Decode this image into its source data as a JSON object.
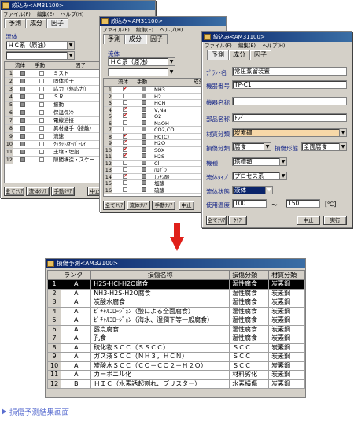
{
  "window1": {
    "title": "絞込み<AM31100>",
    "menu": [
      "ファイル(F)",
      "編集(E)",
      "ヘルプ(H)"
    ],
    "tabs": [
      "予測",
      "成分",
      "因子"
    ],
    "fluid_label": "流体",
    "fluid_value": "ＨＣ系（原油）",
    "grid_head": [
      "流体",
      "手動",
      "因子"
    ],
    "rows": [
      {
        "n": "1",
        "t": "ミスト"
      },
      {
        "n": "2",
        "t": "固体粒子"
      },
      {
        "n": "3",
        "t": "応力（熱応力）"
      },
      {
        "n": "4",
        "t": "ＳＲ"
      },
      {
        "n": "5",
        "t": "振動"
      },
      {
        "n": "6",
        "t": "保温保冷"
      },
      {
        "n": "7",
        "t": "電線溶接"
      },
      {
        "n": "8",
        "t": "異材継手（接触）"
      },
      {
        "n": "9",
        "t": "流速"
      },
      {
        "n": "10",
        "t": "ｸｯｸｯﾄ/ｵｰﾊﾞｰﾚｲ"
      },
      {
        "n": "11",
        "t": "土壌・埋設"
      },
      {
        "n": "12",
        "t": "隙間構造・スケー"
      }
    ],
    "buttons": [
      "全てｸﾘｱ",
      "流体ｸﾘｱ",
      "手動ｸﾘｱ",
      "中止"
    ]
  },
  "window2": {
    "title": "絞込み<AM31100>",
    "menu": [
      "ファイル(F)",
      "編集(E)",
      "ヘルプ(H)"
    ],
    "tabs": [
      "予測",
      "成分",
      "因子"
    ],
    "fluid_label": "流体",
    "fluid_value": "ＨＣ系（原油）",
    "grid_head": [
      "流体",
      "手動",
      "成分"
    ],
    "rows": [
      {
        "n": "1",
        "t": "NH3",
        "chk": true
      },
      {
        "n": "2",
        "t": "H2",
        "chk": false
      },
      {
        "n": "3",
        "t": "HCN",
        "chk": false
      },
      {
        "n": "4",
        "t": "V,Na",
        "chk": true
      },
      {
        "n": "5",
        "t": "O2",
        "chk": true
      },
      {
        "n": "6",
        "t": "NaOH",
        "chk": false
      },
      {
        "n": "7",
        "t": "CO2,CO",
        "chk": false
      },
      {
        "n": "8",
        "t": "HC(C)",
        "chk": true
      },
      {
        "n": "9",
        "t": "H2O",
        "chk": true
      },
      {
        "n": "10",
        "t": "SOX",
        "chk": true
      },
      {
        "n": "11",
        "t": "H2S",
        "chk": true
      },
      {
        "n": "12",
        "t": "Cl-",
        "chk": false
      },
      {
        "n": "13",
        "t": "ﾊﾛｹﾞﾝ",
        "chk": false
      },
      {
        "n": "14",
        "t": "ﾅﾌﾃﾝ酸",
        "chk": true
      },
      {
        "n": "15",
        "t": "塩酸",
        "chk": false
      },
      {
        "n": "16",
        "t": "硫酸",
        "chk": false
      }
    ],
    "buttons": [
      "全てｸﾘｱ",
      "流体ｸﾘｱ",
      "手動ｸﾘｱ",
      "中止"
    ]
  },
  "window3": {
    "title": "絞込み<AM31100>",
    "menu": [
      "ファイル(F)",
      "編集(E)",
      "ヘルプ(H)"
    ],
    "tabs": [
      "予測",
      "成分",
      "因子"
    ],
    "fields": {
      "plant_label": "ﾌﾟﾗﾝﾄ名",
      "plant_value": "常圧蒸留装置",
      "equip_no_label": "機器番号",
      "equip_no_value": "TP-C1",
      "equip_name_label": "機器名称",
      "equip_name_value": "",
      "part_label": "部品名称",
      "part_value": "ﾄﾚｲ",
      "material_label": "材質分類",
      "material_value": "炭素鋼",
      "damage_label": "損傷分類",
      "damage_value": "腐食",
      "damage_form_label": "損傷形態",
      "damage_form_value": "全面腐食",
      "type_label": "機種",
      "type_value": "塔槽類",
      "fluid_type_label": "流体ﾀｲﾌﾟ",
      "fluid_type_value": "プロセス系",
      "fluid_state_label": "流体状態",
      "fluid_state_value": "液体",
      "temp_label": "使用温度",
      "temp_from": "100",
      "temp_tilde": "～",
      "temp_to": "150",
      "temp_unit": "[℃]"
    },
    "buttons": [
      "全てｸﾘｱ",
      "ｸﾘｱ",
      "中止",
      "実行"
    ]
  },
  "result": {
    "title": "損傷予測<AM32100>",
    "headers": [
      "",
      "ランク",
      "損傷名称",
      "損傷分類",
      "材質分類"
    ],
    "rows": [
      {
        "n": "1",
        "rank": "A",
        "name": "H2S-HCl-H2O腐食",
        "cls": "湿性腐食",
        "mat": "炭素鋼"
      },
      {
        "n": "2",
        "rank": "A",
        "name": "NH3-H2S-H2O腐食",
        "cls": "湿性腐食",
        "mat": "炭素鋼"
      },
      {
        "n": "3",
        "rank": "A",
        "name": "炭酸水腐食",
        "cls": "湿性腐食",
        "mat": "炭素鋼"
      },
      {
        "n": "4",
        "rank": "A",
        "name": "ﾋﾟﾁｬﾙｺﾛｰｼﾞｮﾝ（酸による全面腐食）",
        "cls": "湿性腐食",
        "mat": "炭素鋼"
      },
      {
        "n": "5",
        "rank": "A",
        "name": "ﾋﾟﾁｬﾙｺﾛｰｼﾞｮﾝ（海水、湿潤下等一般腐食）",
        "cls": "湿性腐食",
        "mat": "炭素鋼"
      },
      {
        "n": "6",
        "rank": "A",
        "name": "露点腐食",
        "cls": "湿性腐食",
        "mat": "炭素鋼"
      },
      {
        "n": "7",
        "rank": "A",
        "name": "孔食",
        "cls": "湿性腐食",
        "mat": "炭素鋼"
      },
      {
        "n": "8",
        "rank": "A",
        "name": "硫化物ＳＣＣ（ＳＳＣＣ）",
        "cls": "ＳＣＣ",
        "mat": "炭素鋼"
      },
      {
        "n": "9",
        "rank": "A",
        "name": "ガス液ＳＣＣ（ＮＨ３，ＨＣＮ）",
        "cls": "ＳＣＣ",
        "mat": "炭素鋼"
      },
      {
        "n": "10",
        "rank": "A",
        "name": "炭酸水ＳＣＣ（ＣＯ－ＣＯ２－Ｈ２Ｏ）",
        "cls": "ＳＣＣ",
        "mat": "炭素鋼"
      },
      {
        "n": "11",
        "rank": "A",
        "name": "カーボニル化",
        "cls": "材料劣化",
        "mat": "炭素鋼"
      },
      {
        "n": "12",
        "rank": "B",
        "name": "ＨＩＣ（水素誘起割れ、ブリスター）",
        "cls": "水素損傷",
        "mat": "炭素鋼"
      }
    ]
  },
  "caption": "損傷予測結果画面",
  "colors": {
    "accent": "#e0201a",
    "caption": "#5a6ed0",
    "titlebar": "#0a246a"
  }
}
